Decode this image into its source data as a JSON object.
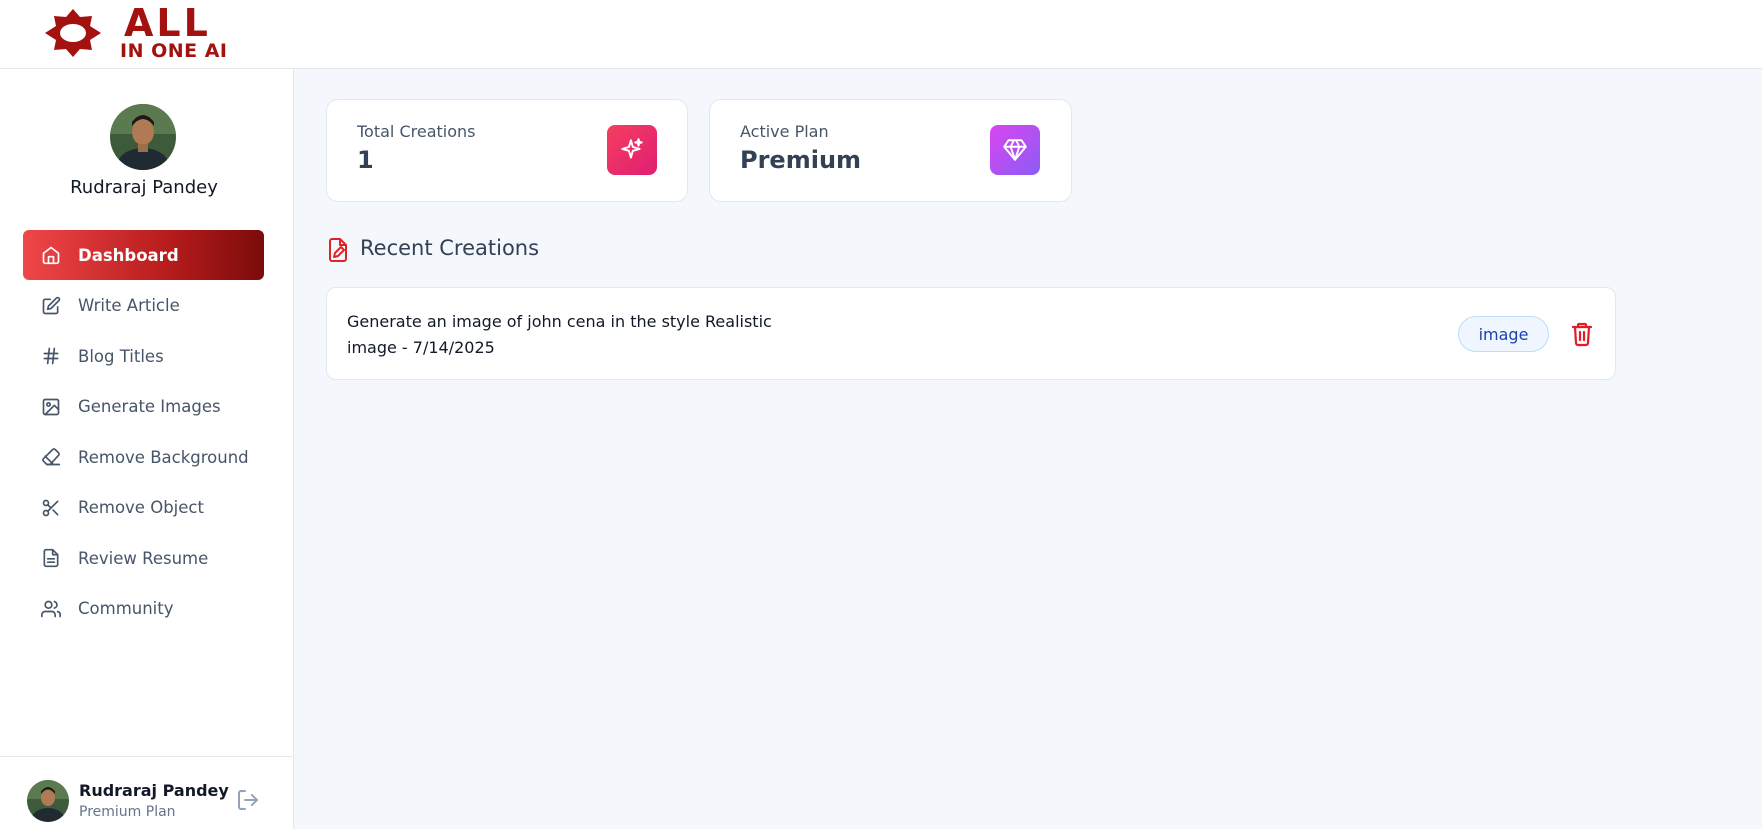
{
  "brand": {
    "line1": "ALL",
    "line2": "IN ONE AI",
    "color": "#a3120f"
  },
  "sidebar": {
    "profile_name": "Rudraraj Pandey",
    "items": [
      {
        "label": "Dashboard",
        "icon": "home-icon",
        "active": true
      },
      {
        "label": "Write Article",
        "icon": "pencil-square-icon",
        "active": false
      },
      {
        "label": "Blog Titles",
        "icon": "hash-icon",
        "active": false
      },
      {
        "label": "Generate Images",
        "icon": "image-icon",
        "active": false
      },
      {
        "label": "Remove Background",
        "icon": "eraser-icon",
        "active": false
      },
      {
        "label": "Remove Object",
        "icon": "scissors-icon",
        "active": false
      },
      {
        "label": "Review Resume",
        "icon": "file-text-icon",
        "active": false
      },
      {
        "label": "Community",
        "icon": "users-icon",
        "active": false
      }
    ],
    "footer": {
      "name": "Rudraraj Pandey",
      "plan": "Premium Plan",
      "logout_icon": "logout-icon"
    }
  },
  "stats": {
    "total_creations": {
      "label": "Total Creations",
      "value": "1",
      "icon": "sparkles-icon",
      "color": "#e91e63"
    },
    "active_plan": {
      "label": "Active Plan",
      "value": "Premium",
      "icon": "gem-icon",
      "color": "#b05ce6"
    }
  },
  "recent": {
    "title": "Recent Creations",
    "icon": "file-edit-icon",
    "items": [
      {
        "prompt": "Generate an image of john cena in the style Realistic",
        "meta": "image - 7/14/2025",
        "type": "image"
      }
    ]
  },
  "colors": {
    "accent_start": "#f0474a",
    "accent_end": "#7b0b0b",
    "delete": "#e11d2a",
    "background": "#f4f7fb"
  }
}
